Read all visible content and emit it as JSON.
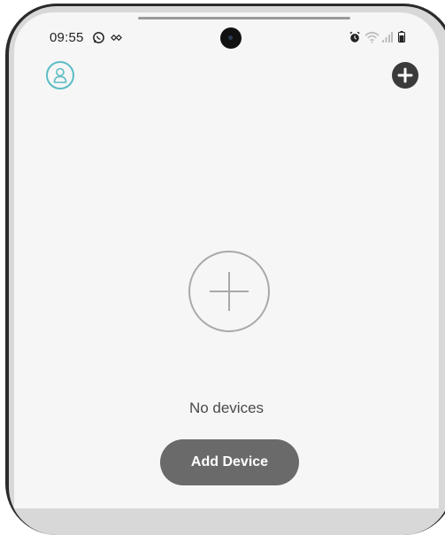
{
  "status_bar": {
    "time": "09:55",
    "icons": [
      "whatsapp-icon",
      "sync-icon",
      "alarm-icon",
      "wifi-icon",
      "signal-icon",
      "battery-icon"
    ]
  },
  "header": {
    "profile_icon": "profile-icon",
    "add_icon": "plus-circle-icon"
  },
  "main": {
    "empty_icon": "plus-circle-outline-icon",
    "empty_text": "No devices",
    "add_device_label": "Add Device"
  },
  "colors": {
    "accent": "#5bbcc4",
    "button_bg": "#6a6a6a",
    "screen_bg": "#f6f6f6"
  }
}
